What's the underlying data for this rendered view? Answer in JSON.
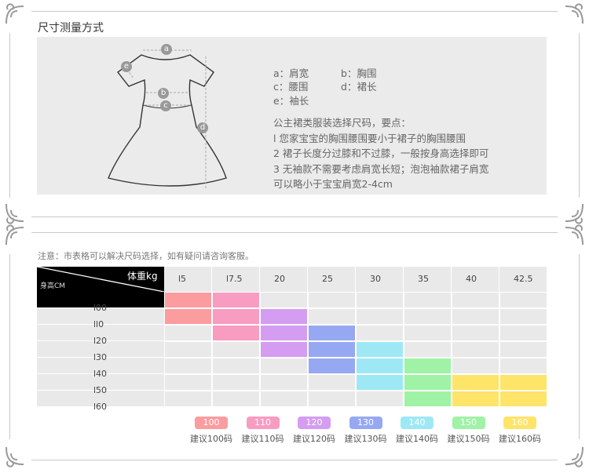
{
  "measure": {
    "title": "尺寸测量方式",
    "diagram_letters": [
      "a",
      "e",
      "b",
      "c",
      "d"
    ],
    "dims": [
      {
        "key": "a：",
        "label": "肩宽"
      },
      {
        "key": "b：",
        "label": "胸围"
      },
      {
        "key": "c：",
        "label": "腰围"
      },
      {
        "key": "d：",
        "label": "裙长"
      },
      {
        "key": "e：",
        "label": "袖长"
      }
    ],
    "tips_title": "公主裙类服装选择尺码，要点：",
    "tips": [
      "l  您家宝宝的胸围腰围要小于裙子的胸围腰围",
      "2  裙子长度分过膝和不过膝，一般按身高选择即可",
      "3  无袖款不需要考虑肩宽长短；泡泡袖款裙子肩宽",
      "可以略小于宝宝肩宽2-4cm"
    ]
  },
  "size_chart": {
    "note": "注意：市表格可以解决尺码选择，如有疑问请咨询客服。",
    "weight_header": "体重kg",
    "height_header": "身高CM",
    "weights": [
      "l5",
      "l7.5",
      "20",
      "25",
      "30",
      "35",
      "40",
      "42.5"
    ],
    "heights": [
      "l00",
      "ll0",
      "l20",
      "l30",
      "l40",
      "l50",
      "l60"
    ],
    "chart_data": {
      "type": "table",
      "columns": [
        "l5",
        "l7.5",
        "20",
        "25",
        "30",
        "35",
        "40",
        "42.5"
      ],
      "rows": [
        "身高CM",
        "l00",
        "ll0",
        "l20",
        "l30",
        "l40",
        "l50"
      ],
      "highlighted_sizes": [
        {
          "size": "100",
          "color": "#fb9c9f",
          "row_indices": [
            0,
            1
          ],
          "col_indices": [
            0
          ]
        },
        {
          "size": "110",
          "color": "#f99cc1",
          "row_indices": [
            0,
            1,
            2
          ],
          "col_indices": [
            1
          ]
        },
        {
          "size": "120",
          "color": "#d49df1",
          "row_indices": [
            1,
            2,
            3
          ],
          "col_indices": [
            2
          ]
        },
        {
          "size": "130",
          "color": "#97a8f2",
          "row_indices": [
            2,
            3,
            4
          ],
          "col_indices": [
            3
          ]
        },
        {
          "size": "140",
          "color": "#9ee8f6",
          "row_indices": [
            3,
            4,
            5
          ],
          "col_indices": [
            4
          ]
        },
        {
          "size": "150",
          "color": "#9ff2a6",
          "row_indices": [
            4,
            5,
            6
          ],
          "col_indices": [
            5
          ]
        },
        {
          "size": "160",
          "color": "#fee469",
          "row_indices": [
            5,
            6
          ],
          "col_indices": [
            6,
            7
          ]
        }
      ]
    },
    "legend": [
      {
        "badge": "100",
        "text": "建议100码",
        "color": "#fb9c9f"
      },
      {
        "badge": "110",
        "text": "建议110码",
        "color": "#f99cc1"
      },
      {
        "badge": "120",
        "text": "建议120码",
        "color": "#d49df1"
      },
      {
        "badge": "130",
        "text": "建议130码",
        "color": "#97a8f2"
      },
      {
        "badge": "140",
        "text": "建议140码",
        "color": "#9ee8f6"
      },
      {
        "badge": "150",
        "text": "建议150码",
        "color": "#9ff2a6"
      },
      {
        "badge": "160",
        "text": "建议160码",
        "color": "#fee469"
      }
    ]
  }
}
